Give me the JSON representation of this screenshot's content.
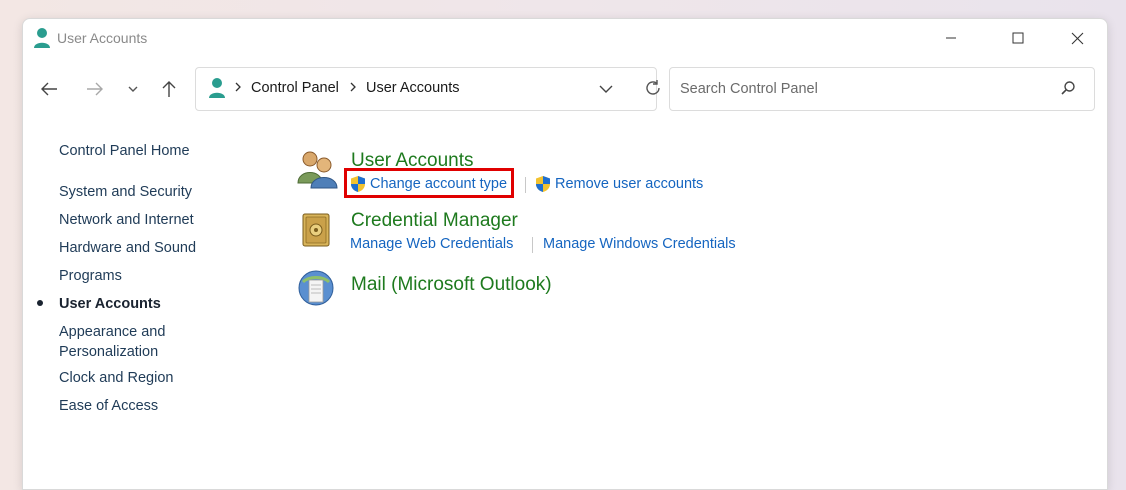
{
  "window": {
    "title": "User Accounts"
  },
  "address_bar": {
    "crumbs": [
      "Control Panel",
      "User Accounts"
    ]
  },
  "search": {
    "placeholder": "Search Control Panel"
  },
  "sidebar": {
    "home": "Control Panel Home",
    "items": [
      {
        "label": "System and Security"
      },
      {
        "label": "Network and Internet"
      },
      {
        "label": "Hardware and Sound"
      },
      {
        "label": "Programs"
      },
      {
        "label": "User Accounts",
        "current": true
      },
      {
        "label": "Appearance and",
        "label2": "Personalization"
      },
      {
        "label": "Clock and Region"
      },
      {
        "label": "Ease of Access"
      }
    ]
  },
  "main": {
    "categories": [
      {
        "title": "User Accounts",
        "icon": "users-icon",
        "tasks": [
          "Change account type",
          "Remove user accounts"
        ]
      },
      {
        "title": "Credential Manager",
        "icon": "vault-icon",
        "tasks": [
          "Manage Web Credentials",
          "Manage Windows Credentials"
        ]
      },
      {
        "title": "Mail (Microsoft Outlook)",
        "icon": "mail-icon",
        "tasks": []
      }
    ]
  },
  "colors": {
    "category_title": "#1e7a1e",
    "task_link": "#1565c0",
    "highlight": "#e00000"
  }
}
